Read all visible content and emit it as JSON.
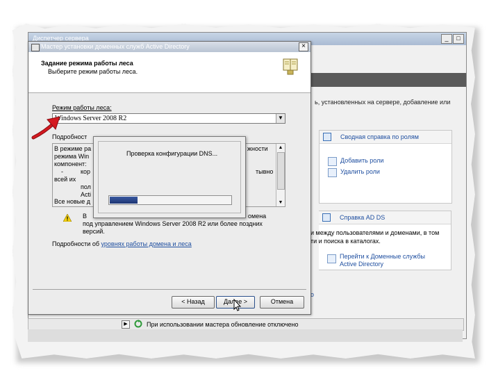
{
  "server_manager": {
    "title": "Диспетчер сервера",
    "right_text": "ь, установленных на сервере, добавление или",
    "roles_panel": {
      "header": "Сводная справка по ролям",
      "add_roles": "Добавить роли",
      "remove_roles": "Удалить роли"
    },
    "adds_panel": {
      "header": "Справка AD DS",
      "text_line1": "и между пользователями и доменами, в том",
      "text_line2": "ти и поиска в каталогах.",
      "goto_link_line1": "Перейти к Доменные службы",
      "goto_link_line2": "Active Directory",
      "stray_link": "о"
    },
    "status": "При использовании мастера обновление отключено"
  },
  "wizard": {
    "title": "Мастер установки доменных служб Active Directory",
    "close_glyph": "×",
    "heading": "Задание режима работы леса",
    "subheading": "Выберите режим работы леса.",
    "mode_label": "Режим работы леса:",
    "mode_value": "Windows Server 2008 R2",
    "dropdown_glyph": "▼",
    "details_label": "Подробност",
    "details_lines": {
      "l1a": "В режиме ра",
      "l1b": "жности",
      "l2": "режима Win",
      "l3": "компонент:",
      "l4a": "-",
      "l4b": "кор",
      "l4c": "тывно",
      "l5": "всей их",
      "l6": "пол",
      "l7": "Acti",
      "l8": "Все новые д"
    },
    "warning_line1a": "В",
    "warning_line1b": "омена",
    "warning_line2": "под управлением Windows Server 2008 R2 или более поздних",
    "warning_line3": "версий.",
    "more_prefix": "Подробности об",
    "more_link": "уровнях работы домена и леса",
    "back_button": "< Назад",
    "next_button": "Далее >",
    "cancel_button": "Отмена"
  },
  "progress_dialog": {
    "text": "Проверка конфигурации DNS...",
    "progress_fraction": 0.23
  },
  "colors": {
    "title_blue": "#b9c4d3",
    "link_blue": "#1f4fa0",
    "progress_fill": "#1c3474",
    "arrow_red": "#c0141a"
  }
}
